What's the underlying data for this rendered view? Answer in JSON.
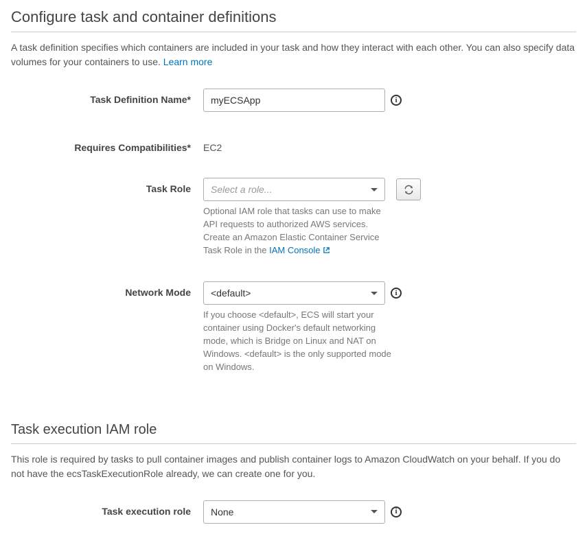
{
  "section1": {
    "title": "Configure task and container definitions",
    "desc_part1": "A task definition specifies which containers are included in your task and how they interact with each other. You can also specify data volumes for your containers to use. ",
    "learn_more": "Learn more"
  },
  "fields": {
    "task_def_name": {
      "label": "Task Definition Name*",
      "value": "myECSApp"
    },
    "requires_compat": {
      "label": "Requires Compatibilities*",
      "value": "EC2"
    },
    "task_role": {
      "label": "Task Role",
      "placeholder": "Select a role...",
      "help_part1": "Optional IAM role that tasks can use to make API requests to authorized AWS services. Create an Amazon Elastic Container Service Task Role in the ",
      "help_link": "IAM Console"
    },
    "network_mode": {
      "label": "Network Mode",
      "value": "<default>",
      "help": "If you choose <default>, ECS will start your container using Docker's default networking mode, which is Bridge on Linux and NAT on Windows. <default> is the only supported mode on Windows."
    }
  },
  "section2": {
    "title": "Task execution IAM role",
    "desc": "This role is required by tasks to pull container images and publish container logs to Amazon CloudWatch on your behalf. If you do not have the ecsTaskExecutionRole already, we can create one for you."
  },
  "exec_role": {
    "label": "Task execution role",
    "value": "None"
  }
}
